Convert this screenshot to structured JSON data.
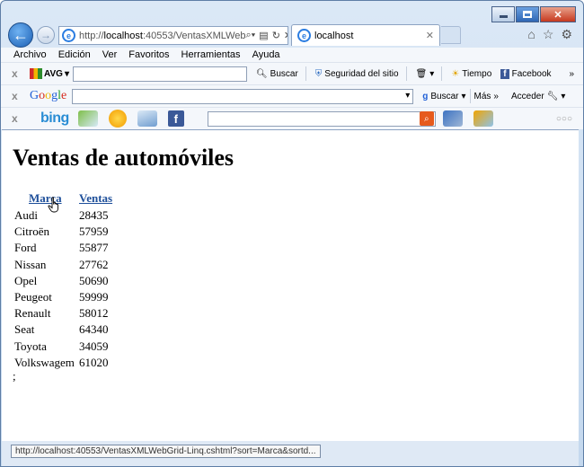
{
  "browser": {
    "address": {
      "prefix": "http://",
      "host": "localhost",
      "rest": ":40553/VentasXMLWeb"
    },
    "tab_title": "localhost",
    "menu": [
      "Archivo",
      "Edición",
      "Ver",
      "Favoritos",
      "Herramientas",
      "Ayuda"
    ],
    "avg_toolbar": {
      "logo": "AVG",
      "search": "Buscar",
      "security": "Seguridad del sitio",
      "weather": "Tiempo",
      "facebook": "Facebook"
    },
    "google_toolbar": {
      "logo": [
        "G",
        "o",
        "o",
        "g",
        "l",
        "e"
      ],
      "search": "Buscar",
      "more": "Más",
      "signin": "Acceder"
    },
    "bing_toolbar": {
      "logo": "bing",
      "fb": "f"
    },
    "status_url": "http://localhost:40553/VentasXMLWebGrid-Linq.cshtml?sort=Marca&sortd..."
  },
  "page": {
    "title": "Ventas de automóviles",
    "columns": {
      "marca": "Marca",
      "ventas": "Ventas"
    },
    "rows": [
      {
        "marca": "Audi",
        "ventas": "28435"
      },
      {
        "marca": "Citroën",
        "ventas": "57959"
      },
      {
        "marca": "Ford",
        "ventas": "55877"
      },
      {
        "marca": "Nissan",
        "ventas": "27762"
      },
      {
        "marca": "Opel",
        "ventas": "50690"
      },
      {
        "marca": "Peugeot",
        "ventas": "59999"
      },
      {
        "marca": "Renault",
        "ventas": "58012"
      },
      {
        "marca": "Seat",
        "ventas": "64340"
      },
      {
        "marca": "Toyota",
        "ventas": "34059"
      },
      {
        "marca": "Volkswagem",
        "ventas": "61020"
      }
    ],
    "trailing": ";"
  }
}
